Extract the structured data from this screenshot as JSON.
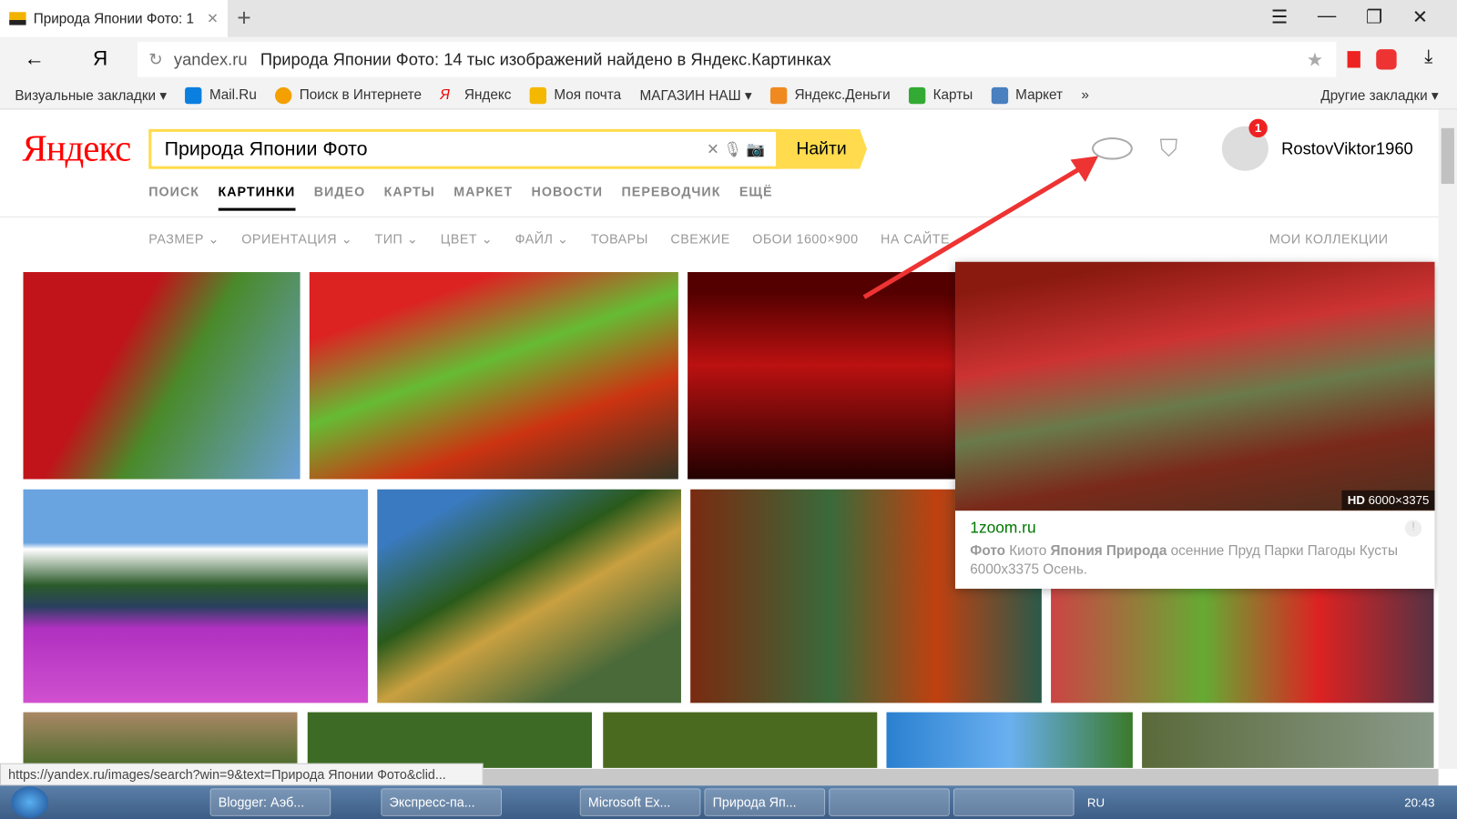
{
  "browser": {
    "tab_title": "Природа Японии Фото: 1",
    "url_domain": "yandex.ru",
    "url_title": "Природа Японии Фото: 14 тыс изображений найдено в Яндекс.Картинках",
    "yandex_btn": "Я",
    "bookmarks": [
      "Визуальные закладки ▾",
      "Mail.Ru",
      "Поиск в Интернете",
      "Яндекс",
      "Моя почта",
      "МАГАЗИН НАШ ▾",
      "Яндекс.Деньги",
      "Карты",
      "Маркет",
      "»"
    ],
    "other_bookmarks": "Другие закладки ▾"
  },
  "page": {
    "logo": "Яндекс",
    "search_value": "Природа Японии Фото",
    "find_label": "Найти",
    "user": "RostovViktor1960",
    "notifications": "1",
    "nav": [
      "ПОИСК",
      "КАРТИНКИ",
      "ВИДЕО",
      "КАРТЫ",
      "МАРКЕТ",
      "НОВОСТИ",
      "ПЕРЕВОДЧИК",
      "ЕЩЁ"
    ],
    "filters": [
      "РАЗМЕР ⌄",
      "ОРИЕНТАЦИЯ ⌄",
      "ТИП ⌄",
      "ЦВЕТ ⌄",
      "ФАЙЛ ⌄",
      "ТОВАРЫ",
      "СВЕЖИЕ",
      "ОБОИ 1600×900",
      "НА САЙТЕ"
    ],
    "collections": "МОИ КОЛЛЕКЦИИ",
    "popup": {
      "hd": "HD",
      "size": "6000×3375",
      "site": "1zoom.ru",
      "desc_b1": "Фото",
      "desc_1": " Киото ",
      "desc_b2": "Япония Природа",
      "desc_2": " осенние Пруд Парки Пагоды Кусты 6000x3375 Осень."
    }
  },
  "status_url": "https://yandex.ru/images/search?win=9&text=Природа Японии Фото&clid...",
  "taskbar": {
    "items": [
      "Blogger: Аэб...",
      "Экспресс-па...",
      "Microsoft Ex...",
      "Природа Яп..."
    ],
    "lang": "RU",
    "time": "20:43"
  }
}
